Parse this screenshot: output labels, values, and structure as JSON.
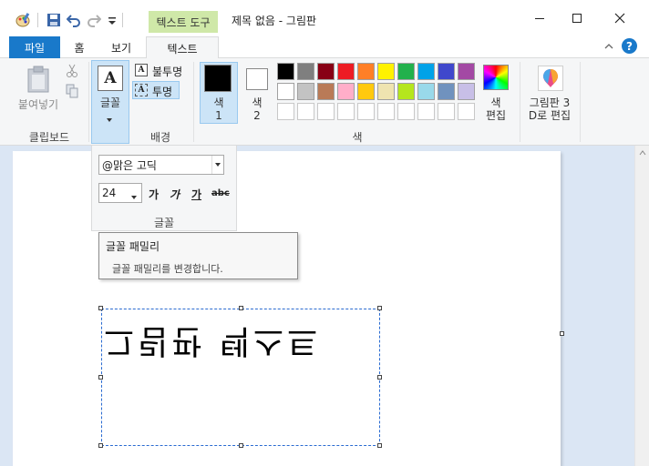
{
  "titlebar": {
    "context_tab": "텍스트 도구",
    "title": "제목 없음 - 그림판"
  },
  "tabs": {
    "file": "파일",
    "home": "홈",
    "view": "보기",
    "text": "텍스트"
  },
  "ribbon": {
    "clipboard": {
      "paste": "붙여넣기",
      "label": "클립보드"
    },
    "font": {
      "button": "글꼴"
    },
    "background": {
      "opaque": "불투명",
      "transparent": "투명",
      "label": "배경"
    },
    "colors": {
      "color1_a": "색",
      "color1_b": "1",
      "color2_a": "색",
      "color2_b": "2",
      "edit_a": "색",
      "edit_b": "편집",
      "label": "색",
      "color1_value": "#000000",
      "color2_value": "#ffffff",
      "palette_row1": [
        "#000000",
        "#7f7f7f",
        "#880015",
        "#ed1c24",
        "#ff7f27",
        "#fff200",
        "#22b14c",
        "#00a2e8",
        "#3f48cc",
        "#a349a4"
      ],
      "palette_row2": [
        "#ffffff",
        "#c3c3c3",
        "#b97a57",
        "#ffaec9",
        "#ffc90e",
        "#efe4b0",
        "#b5e61d",
        "#99d9ea",
        "#7092be",
        "#c8bfe7"
      ]
    },
    "paint3d": {
      "line1": "그림판 3",
      "line2": "D로 편집"
    }
  },
  "font_panel": {
    "font_name": "@맑은 고딕",
    "font_size": "24",
    "bold": "가",
    "italic": "가",
    "underline": "가",
    "strike": "abc",
    "label": "글꼴"
  },
  "tooltip": {
    "title": "글꼴 패밀리",
    "body": "글꼴 패밀리를 변경합니다."
  },
  "canvas": {
    "text": "그림판 텍스트"
  }
}
